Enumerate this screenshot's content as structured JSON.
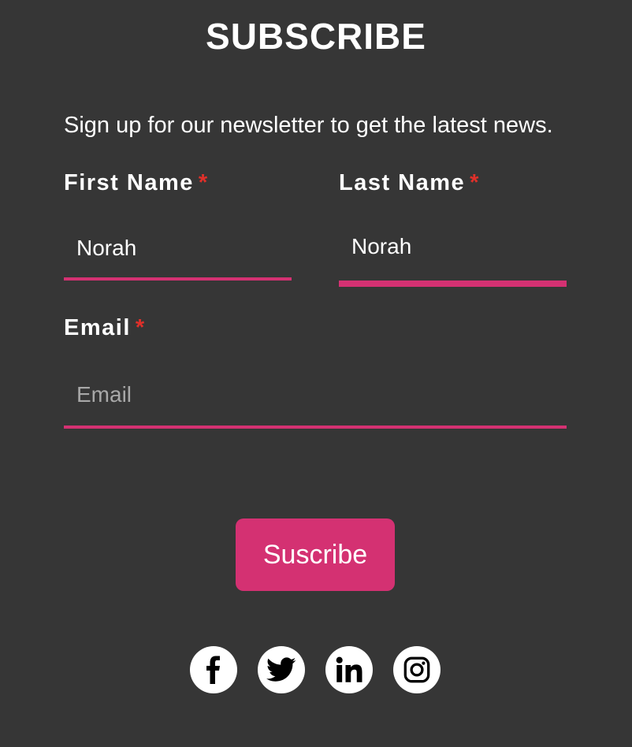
{
  "header": {
    "title": "SUBSCRIBE"
  },
  "intro": {
    "text": "Sign up for our newsletter to get the latest news."
  },
  "form": {
    "first_name": {
      "label": "First Name",
      "required_mark": "*",
      "value": "Norah"
    },
    "last_name": {
      "label": "Last Name",
      "required_mark": "*",
      "value": "Norah"
    },
    "email": {
      "label": "Email",
      "required_mark": "*",
      "value": "",
      "placeholder": "Email"
    },
    "submit_label": "Suscribe"
  },
  "social": {
    "icons": [
      "facebook-icon",
      "twitter-icon",
      "linkedin-icon",
      "instagram-icon"
    ]
  },
  "colors": {
    "background": "#363636",
    "accent": "#d43172",
    "required": "#e0302a",
    "text": "#ffffff"
  }
}
